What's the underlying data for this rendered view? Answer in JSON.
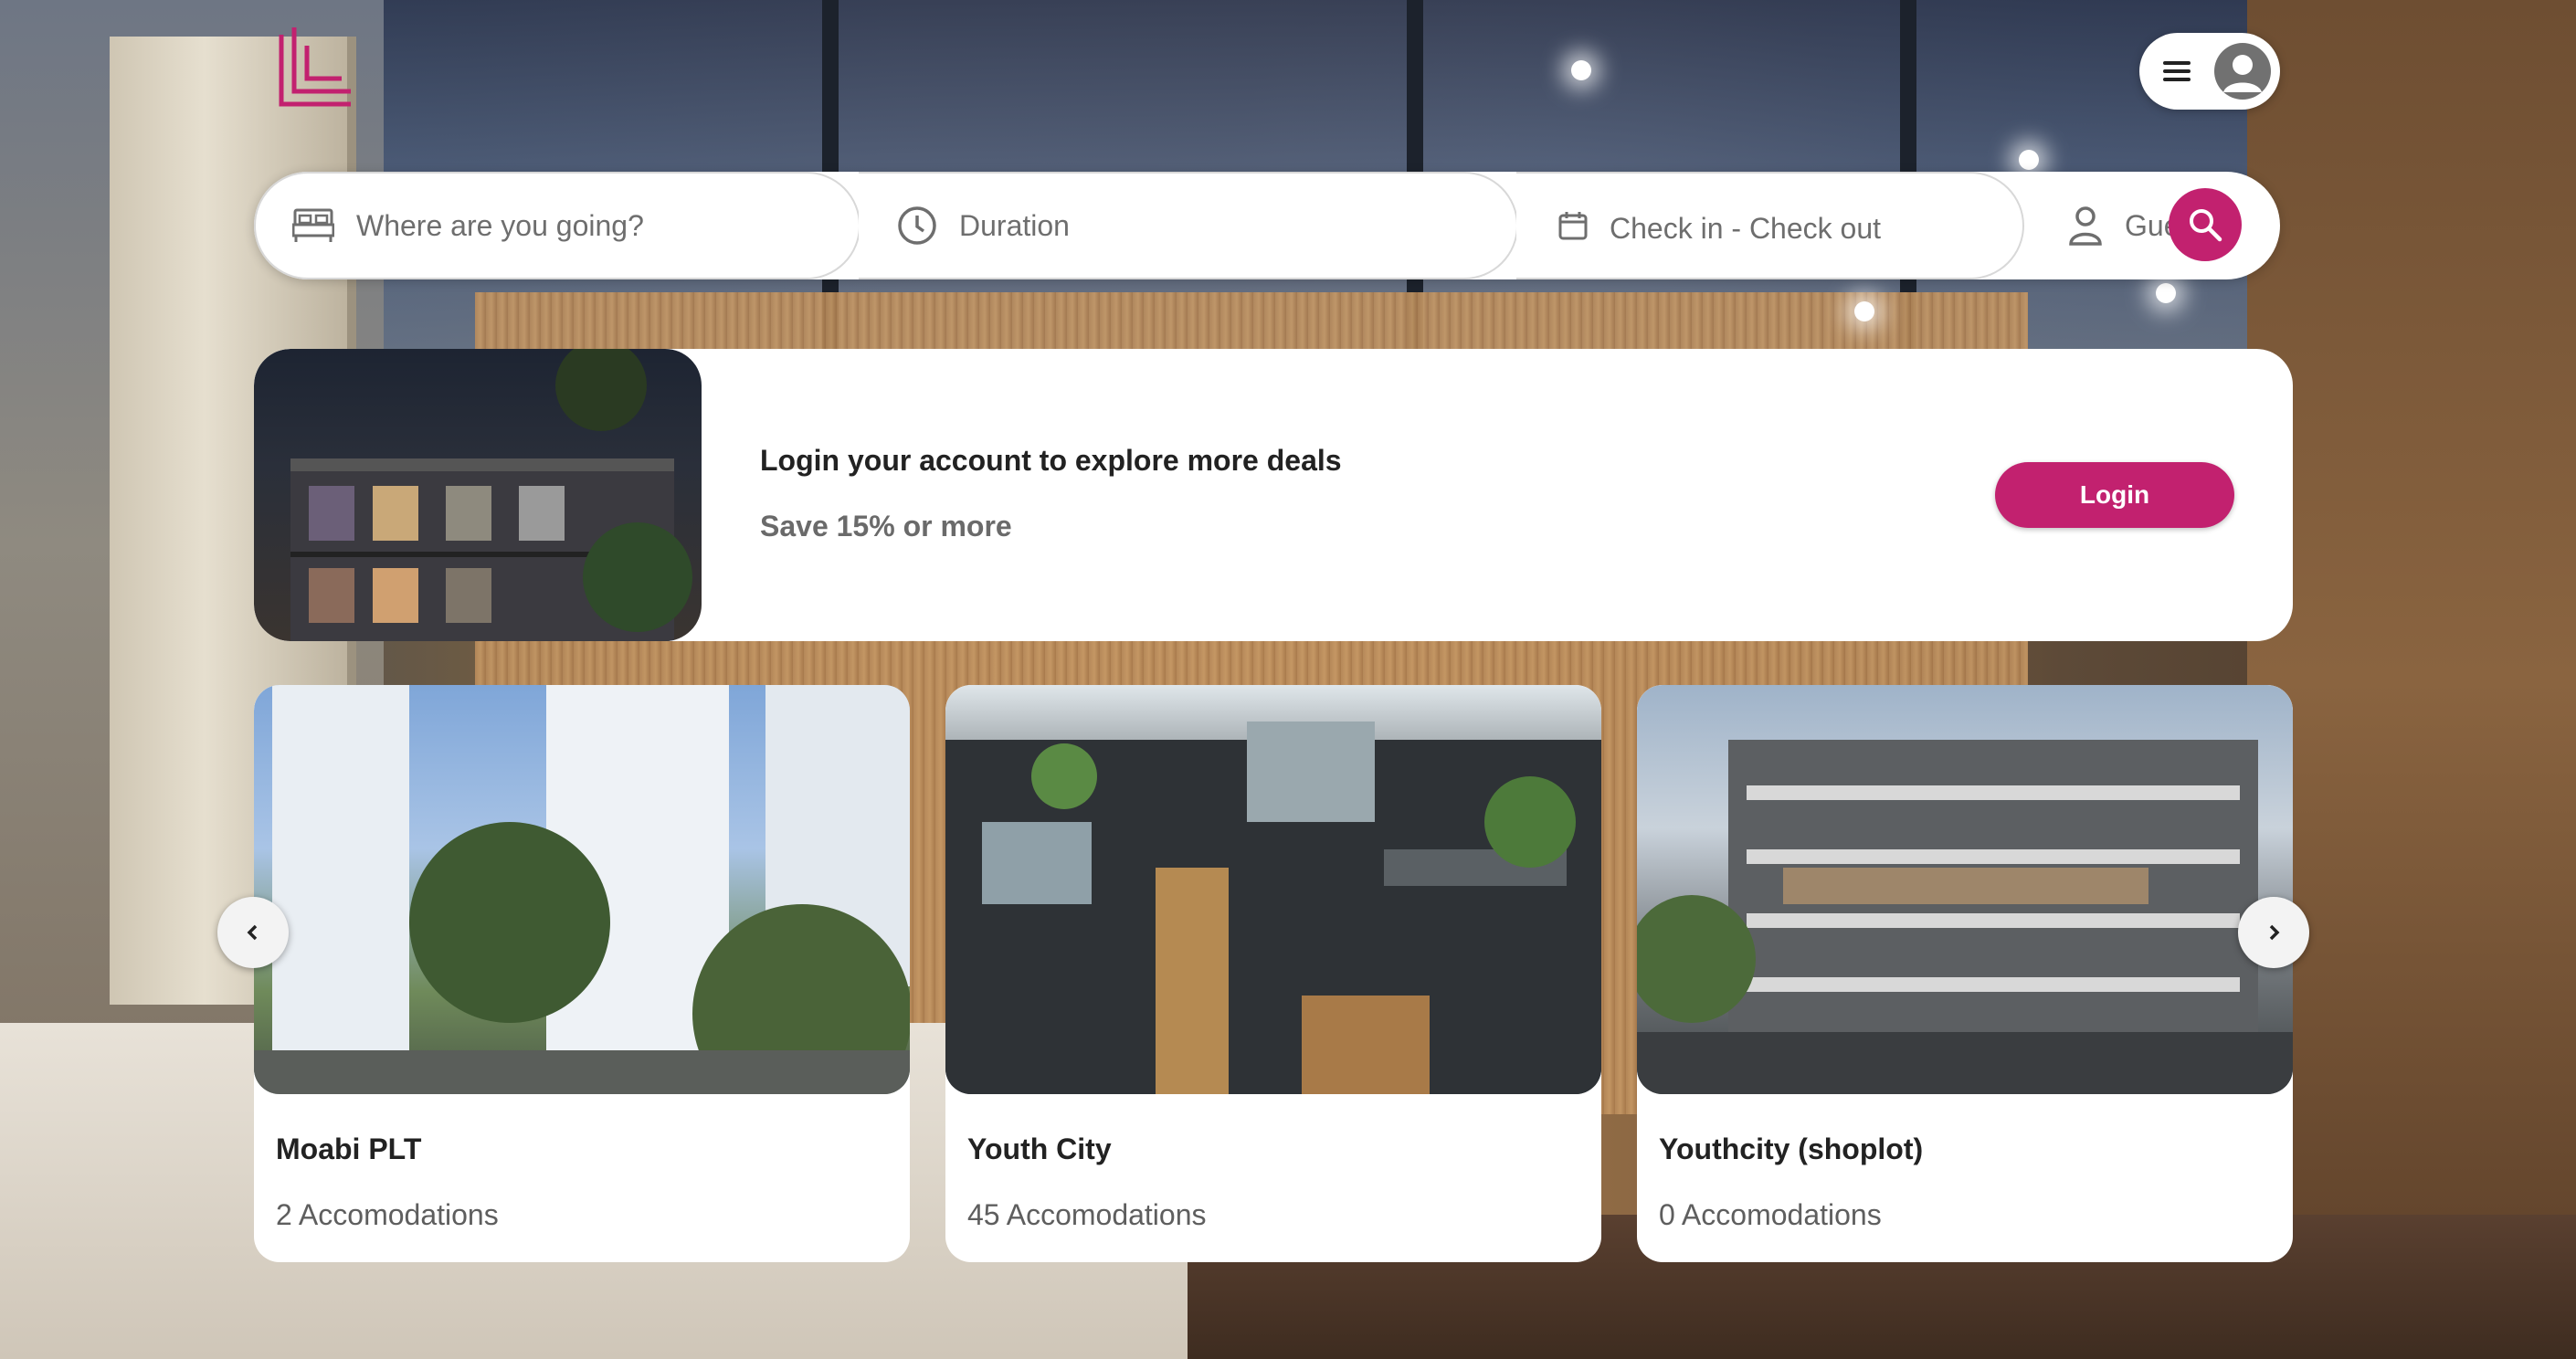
{
  "brand": {
    "logo_icon": "LL-logo-icon",
    "accent_color": "#c2216f"
  },
  "header": {
    "menu_icon": "hamburger-icon",
    "avatar_icon": "user-avatar-icon"
  },
  "search": {
    "destination_placeholder": "Where are you going?",
    "duration_placeholder": "Duration",
    "dates_placeholder": "Check in - Check out",
    "guests_placeholder": "Guests",
    "icons": [
      "bed-icon",
      "clock-icon",
      "calendar-icon",
      "person-icon",
      "search-icon"
    ]
  },
  "promo": {
    "title": "Login your account to explore more deals",
    "subtitle": "Save 15% or more",
    "login_label": "Login"
  },
  "properties": [
    {
      "name": "Moabi PLT",
      "accommodations": "2 Accomodations"
    },
    {
      "name": "Youth City",
      "accommodations": "45 Accomodations"
    },
    {
      "name": "Youthcity (shoplot)",
      "accommodations": "0 Accomodations"
    }
  ],
  "carousel": {
    "prev_icon": "chevron-left-icon",
    "next_icon": "chevron-right-icon"
  }
}
